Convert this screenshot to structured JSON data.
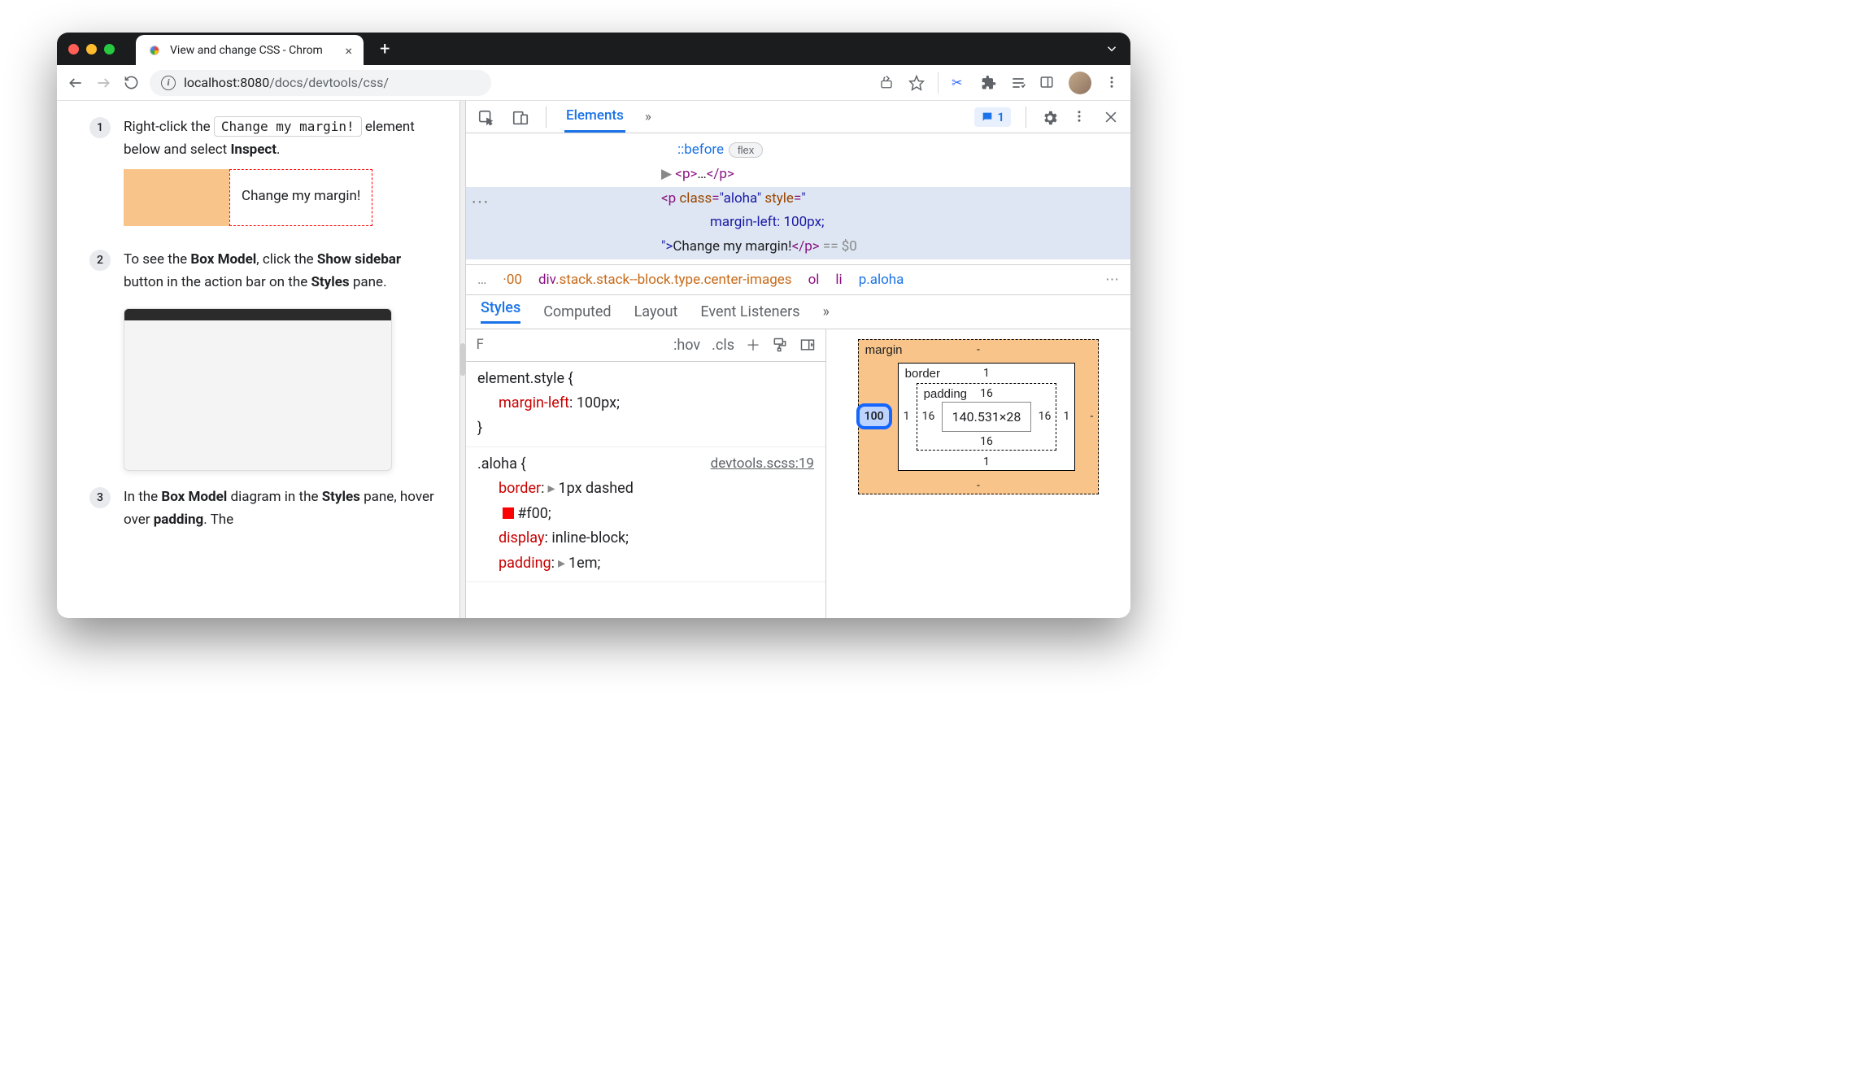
{
  "browser": {
    "tab_title": "View and change CSS - Chrom",
    "url_host": "localhost:",
    "url_port": "8080",
    "url_path": "/docs/devtools/css/"
  },
  "steps": {
    "s1_pre": "Right-click the ",
    "s1_code": "Change my margin!",
    "s1_post": " element below and select ",
    "s1_bold": "Inspect",
    "s1_end": ".",
    "margin_btn": "Change my margin!",
    "s2_a": "To see the ",
    "s2_b": "Box Model",
    "s2_c": ", click the ",
    "s2_d": "Show sidebar",
    "s2_e": " button in the action bar on the ",
    "s2_f": "Styles",
    "s2_g": " pane.",
    "s3_a": "In the ",
    "s3_b": "Box Model",
    "s3_c": " diagram in the ",
    "s3_d": "Styles",
    "s3_e": " pane, hover over ",
    "s3_f": "padding",
    "s3_g": ". The"
  },
  "devtools": {
    "tab_elements": "Elements",
    "msg_count": "1",
    "dom": {
      "before": "::before",
      "flex": "flex",
      "p_open": "<p>",
      "p_ell": "…",
      "p_close": "</p>",
      "sel_open1": "<p ",
      "sel_attr_class": "class",
      "sel_val_class": "\"aloha\"",
      "sel_attr_style": "style",
      "sel_val_style_open": "\"",
      "sel_style_line": "margin-left: 100px;",
      "sel_val_style_close": "\">",
      "sel_text": "Change my margin!",
      "sel_close": "</p>",
      "sel_eq": " == $0"
    },
    "breadcrumb": {
      "trunc": "…",
      "n00": "00",
      "long": "div.stack.stack--block.type.center-images",
      "ol": "ol",
      "li": "li",
      "p": "p.aloha"
    },
    "styles_tabs": {
      "styles": "Styles",
      "computed": "Computed",
      "layout": "Layout",
      "ev": "Event Listeners"
    },
    "filter": {
      "placeholder": "F",
      "hov": ":hov",
      "cls": ".cls"
    },
    "rules": {
      "r1_sel": "element.style {",
      "r1_p1": "margin-left",
      "r1_v1": "100px",
      "r1_close": "}",
      "r2_sel": ".aloha {",
      "r2_src": "devtools.scss:19",
      "r2_p1": "border",
      "r2_v1a": "1px dashed",
      "r2_v1b": "#f00",
      "r2_p2": "display",
      "r2_v2": "inline-block",
      "r2_p3": "padding",
      "r2_v3": "1em"
    },
    "box": {
      "margin": "margin",
      "border": "border",
      "padding": "padding",
      "m_top": "-",
      "m_right": "-",
      "m_bottom": "-",
      "m_left": "100",
      "b_all": "1",
      "p_all": "16",
      "content": "140.531×28"
    }
  }
}
